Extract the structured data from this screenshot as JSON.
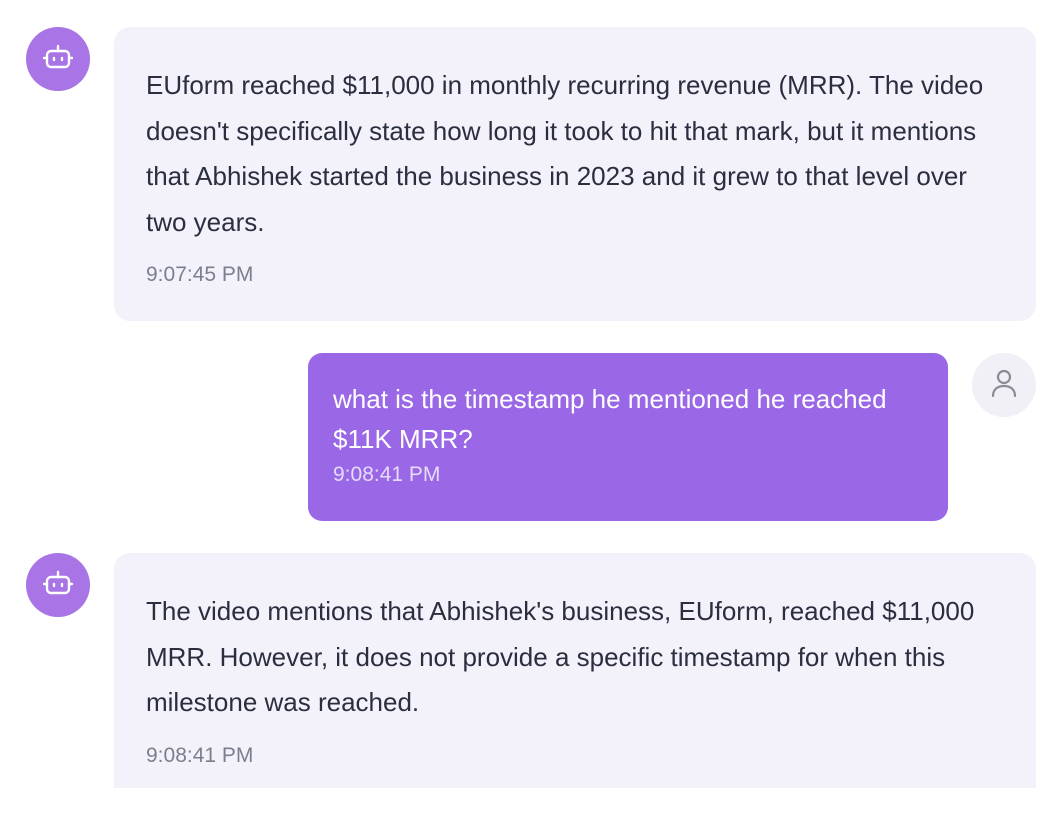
{
  "messages": [
    {
      "role": "bot",
      "avatar_icon": "robot-icon",
      "text": "EUform reached $11,000 in monthly recurring revenue (MRR). The video doesn't specifically state how long it took to hit that mark, but it mentions that Abhishek started the business in 2023 and it grew to that level over two years.",
      "time": "9:07:45 PM"
    },
    {
      "role": "user",
      "avatar_icon": "user-icon",
      "text": "what is the timestamp he mentioned he reached $11K MRR?",
      "time": "9:08:41 PM"
    },
    {
      "role": "bot",
      "avatar_icon": "robot-icon",
      "text": "The video mentions that Abhishek's business, EUform, reached $11,000 MRR. However, it does not provide a specific timestamp for when this milestone was reached.",
      "time": "9:08:41 PM"
    }
  ],
  "colors": {
    "bot_avatar": "#a874e6",
    "bot_bubble": "#f3f2fb",
    "user_bubble": "#9a67e6",
    "user_avatar": "#f1f0f6",
    "text_dark": "#2b2e3f",
    "time_gray": "#7a7e8d"
  }
}
